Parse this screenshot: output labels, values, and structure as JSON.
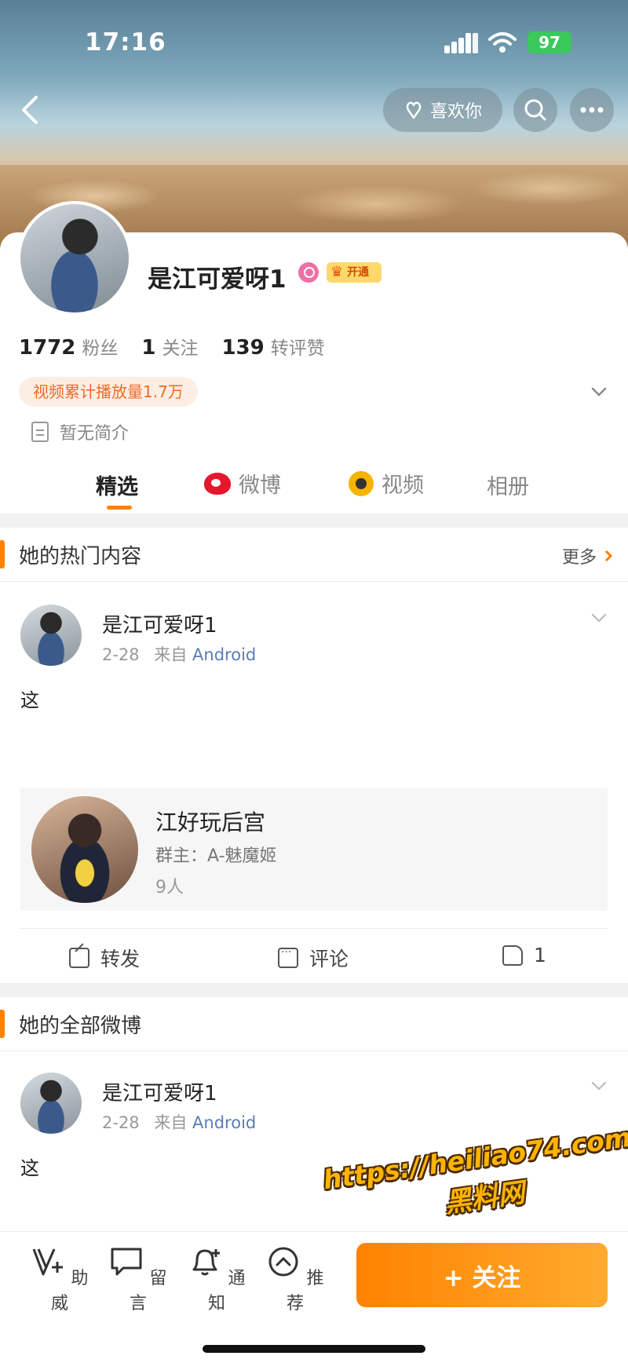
{
  "status_bar": {
    "time": "17:16",
    "battery": "97"
  },
  "header": {
    "like_button": "喜欢你"
  },
  "profile": {
    "name": "是江可爱呀1",
    "vip_badge": "开通",
    "stats": [
      {
        "value": "1772",
        "label": "粉丝"
      },
      {
        "value": "1",
        "label": "关注"
      },
      {
        "value": "139",
        "label": "转评赞"
      }
    ],
    "play_tag": "视频累计播放量1.7万",
    "bio": "暂无简介"
  },
  "tabs": [
    {
      "label": "精选",
      "active": true
    },
    {
      "label": "微博",
      "icon": "weibo-icon"
    },
    {
      "label": "视频",
      "icon": "video-icon"
    },
    {
      "label": "相册"
    }
  ],
  "hot_section": {
    "title": "她的热门内容",
    "more": "更多"
  },
  "post1": {
    "author": "是江可爱呀1",
    "date": "2-28",
    "from": "来自",
    "source": "Android",
    "text": "这",
    "group": {
      "name": "江好玩后宫",
      "owner": "群主：A-魅魔姬",
      "count": "9人"
    },
    "actions": {
      "repost": "转发",
      "comment": "评论",
      "like": "1"
    }
  },
  "all_section": {
    "title": "她的全部微博"
  },
  "post2": {
    "author": "是江可爱呀1",
    "date": "2-28",
    "from": "来自",
    "source": "Android",
    "text": "这"
  },
  "watermark": {
    "url": "https://heiliao74.com",
    "name": "黑料网"
  },
  "bottom_bar": {
    "items": [
      "助威",
      "留言",
      "通知",
      "推荐"
    ],
    "follow": "+ 关注"
  },
  "colors": {
    "accent": "#ff8200",
    "source_link": "#5a7db3",
    "battery": "#3ac95a"
  }
}
